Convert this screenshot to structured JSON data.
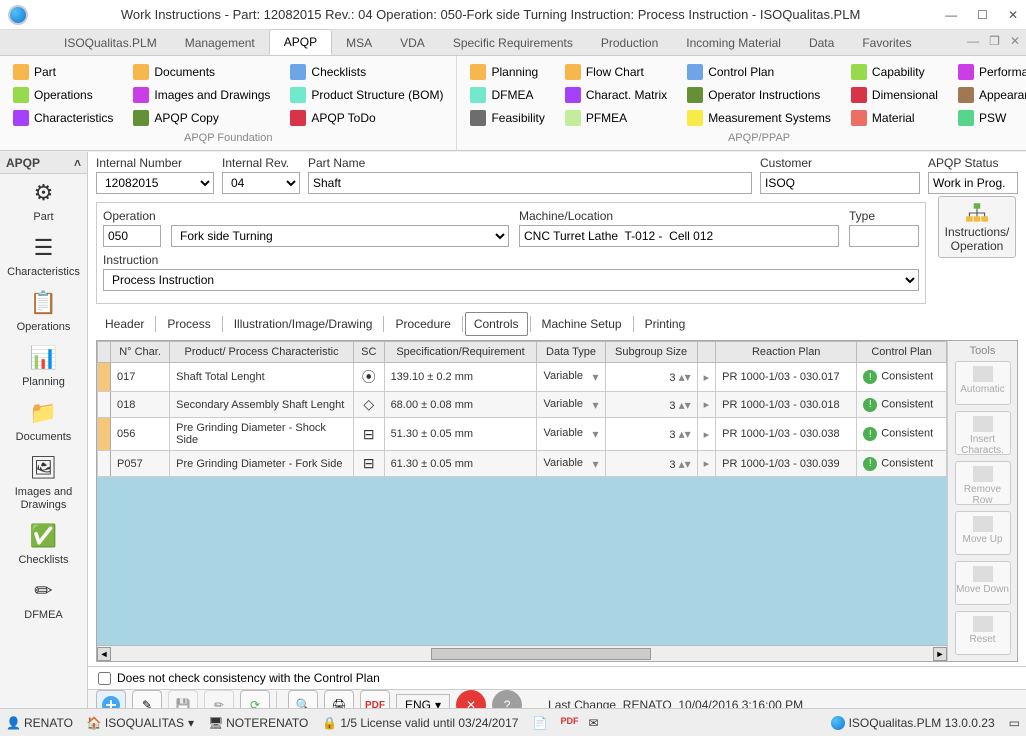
{
  "window": {
    "title": "Work Instructions  - Part: 12082015 Rev.: 04 Operation: 050-Fork side Turning Instruction: Process Instruction - ISOQualitas.PLM"
  },
  "menu": {
    "tabs": [
      "ISOQualitas.PLM",
      "Management",
      "APQP",
      "MSA",
      "VDA",
      "Specific Requirements",
      "Production",
      "Incoming Material",
      "Data",
      "Favorites"
    ],
    "active": 2
  },
  "ribbon": {
    "foundation": {
      "title": "APQP Foundation",
      "items": [
        "Part",
        "Documents",
        "Checklists",
        "Operations",
        "Images and Drawings",
        "Product Structure (BOM)",
        "Characteristics",
        "APQP Copy",
        "APQP ToDo"
      ]
    },
    "ppap": {
      "title": "APQP/PPAP",
      "items": [
        "Planning",
        "Flow Chart",
        "Control Plan",
        "Capability",
        "Performance",
        "DFMEA",
        "Charact. Matrix",
        "Operator Instructions",
        "Dimensional",
        "Appearance",
        "Feasibility",
        "PFMEA",
        "Measurement Systems",
        "Material",
        "PSW"
      ]
    }
  },
  "sidebar": {
    "header": "APQP",
    "items": [
      "Part",
      "Characteristics",
      "Operations",
      "Planning",
      "Documents",
      "Images and Drawings",
      "Checklists",
      "DFMEA"
    ]
  },
  "form": {
    "internal_number_label": "Internal Number",
    "internal_number": "12082015",
    "internal_rev_label": "Internal Rev.",
    "internal_rev": "04",
    "part_name_label": "Part Name",
    "part_name": "Shaft",
    "customer_label": "Customer",
    "customer": "ISOQ",
    "status_label": "APQP Status",
    "status": "Work in Prog.",
    "operation_label": "Operation",
    "operation_code": "050",
    "operation_name": "Fork side Turning",
    "machine_label": "Machine/Location",
    "machine": "CNC Turret Lathe  T-012 -  Cell 012",
    "type_label": "Type",
    "type": "",
    "instruction_label": "Instruction",
    "instruction": "Process Instruction",
    "instr_button": "Instructions/ Operation"
  },
  "subtabs": [
    "Header",
    "Process",
    "Illustration/Image/Drawing",
    "Procedure",
    "Controls",
    "Machine Setup",
    "Printing"
  ],
  "subtabs_active": 4,
  "grid": {
    "headers": [
      "N° Char.",
      "Product/ Process Characteristic",
      "SC",
      "Specification/Requirement",
      "Data Type",
      "Subgroup Size",
      "",
      "Reaction Plan",
      "Control Plan"
    ],
    "rows": [
      {
        "n": "017",
        "char": "Shaft Total Lenght",
        "sc": "⦿",
        "spec": "139.10  ± 0.2 mm",
        "dtype": "Variable",
        "sg": "3",
        "rp": "PR 1000-1/03 - 030.017",
        "cp": "Consistent"
      },
      {
        "n": "018",
        "char": "Secondary Assembly Shaft Lenght",
        "sc": "◇",
        "spec": "68.00  ± 0.08 mm",
        "dtype": "Variable",
        "sg": "3",
        "rp": "PR 1000-1/03 - 030.018",
        "cp": "Consistent"
      },
      {
        "n": "056",
        "char": "Pre Grinding Diameter - Shock Side",
        "sc": "⊟",
        "spec": "51.30  ± 0.05 mm",
        "dtype": "Variable",
        "sg": "3",
        "rp": "PR 1000-1/03 - 030.038",
        "cp": "Consistent"
      },
      {
        "n": "P057",
        "char": "Pre Grinding Diameter - Fork Side",
        "sc": "⊟",
        "spec": "61.30  ± 0.05 mm",
        "dtype": "Variable",
        "sg": "3",
        "rp": "PR 1000-1/03 - 030.039",
        "cp": "Consistent"
      }
    ],
    "checkbox_label": "Does not check consistency with the Control Plan"
  },
  "tools": {
    "header": "Tools",
    "buttons": [
      "Automatic",
      "Insert Characts.",
      "Remove Row",
      "Move Up",
      "Move Down",
      "Reset"
    ]
  },
  "actionbar": {
    "lang": "ENG",
    "lastchange_label": "Last Change",
    "lastchange_user": "RENATO",
    "lastchange_date": "10/04/2016 3:16:00 PM"
  },
  "statusbar": {
    "user": "RENATO",
    "site": "ISOQUALITAS",
    "computer": "NOTERENATO",
    "license": "1/5 License valid until 03/24/2017",
    "version": "ISOQualitas.PLM 13.0.0.23"
  }
}
